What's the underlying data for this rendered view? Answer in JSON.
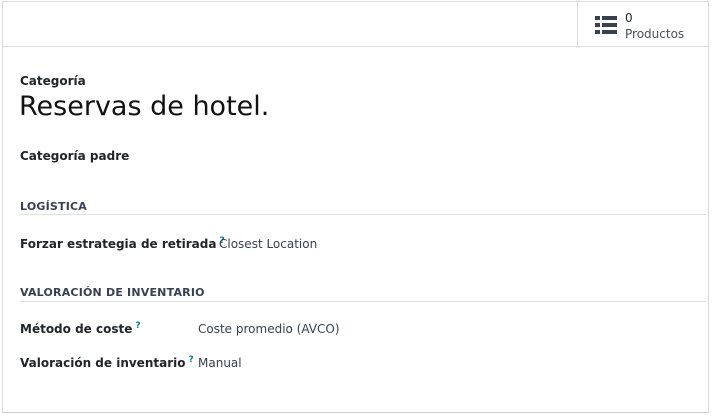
{
  "stat_button": {
    "value": "0",
    "label": "Productos",
    "icon": "list-icon"
  },
  "header": {
    "category_label": "Categoría",
    "record_name": "Reservas de hotel."
  },
  "parent": {
    "label": "Categoría padre"
  },
  "logistics": {
    "title": "LOGÍSTICA",
    "removal_strategy_label": "Forzar estrategia de retirada",
    "removal_strategy_value": "Closest Location",
    "help": "?"
  },
  "valuation": {
    "title": "VALORACIÓN DE INVENTARIO",
    "cost_method_label": "Método de coste",
    "cost_method_value": "Coste promedio (AVCO)",
    "inventory_valuation_label": "Valoración de inventario",
    "inventory_valuation_value": "Manual",
    "help": "?"
  },
  "colors": {
    "help_accent": "#017e84",
    "border": "#d8dadd"
  }
}
